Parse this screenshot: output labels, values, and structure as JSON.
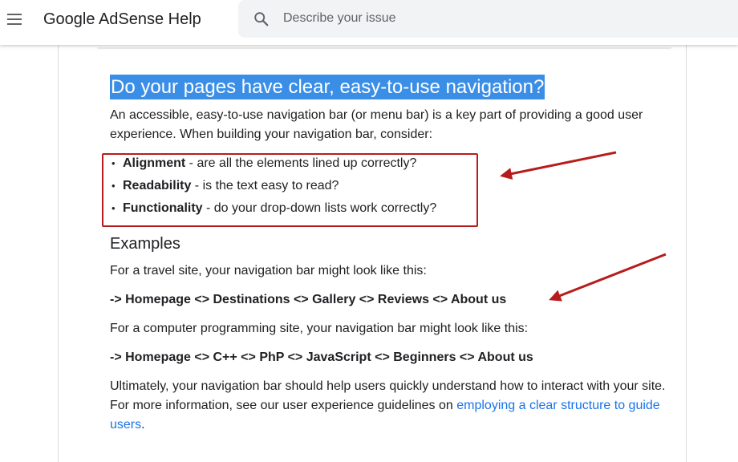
{
  "header": {
    "app_title": "Google AdSense Help",
    "search_placeholder": "Describe your issue"
  },
  "article": {
    "heading": "Do your pages have clear, easy-to-use navigation?",
    "intro": "An accessible, easy-to-use navigation bar (or menu bar) is a key part of providing a good user experience. When building your navigation bar, consider:",
    "considerations": [
      {
        "term": "Alignment",
        "desc": " - are all the elements lined up correctly?"
      },
      {
        "term": "Readability",
        "desc": " - is the text easy to read?"
      },
      {
        "term": "Functionality",
        "desc": " - do your drop-down lists work correctly?"
      }
    ],
    "examples_heading": "Examples",
    "travel_intro": "For a travel site, your navigation bar might look like this:",
    "travel_nav": "-> Homepage <> Destinations <> Gallery <> Reviews <> About us",
    "prog_intro": "For a computer programming site, your navigation bar might look like this:",
    "prog_nav": "-> Homepage <> C++ <> PhP <> JavaScript <> Beginners <> About us",
    "closing_text": "Ultimately, your navigation bar should help users quickly understand how to interact with your site. For more information, see our user experience guidelines on ",
    "closing_link": "employing a clear structure to guide users",
    "closing_end": "."
  },
  "colors": {
    "annotation_red": "#b71c1c",
    "selection_blue": "#3b8ee6",
    "link_blue": "#1a73e8"
  }
}
